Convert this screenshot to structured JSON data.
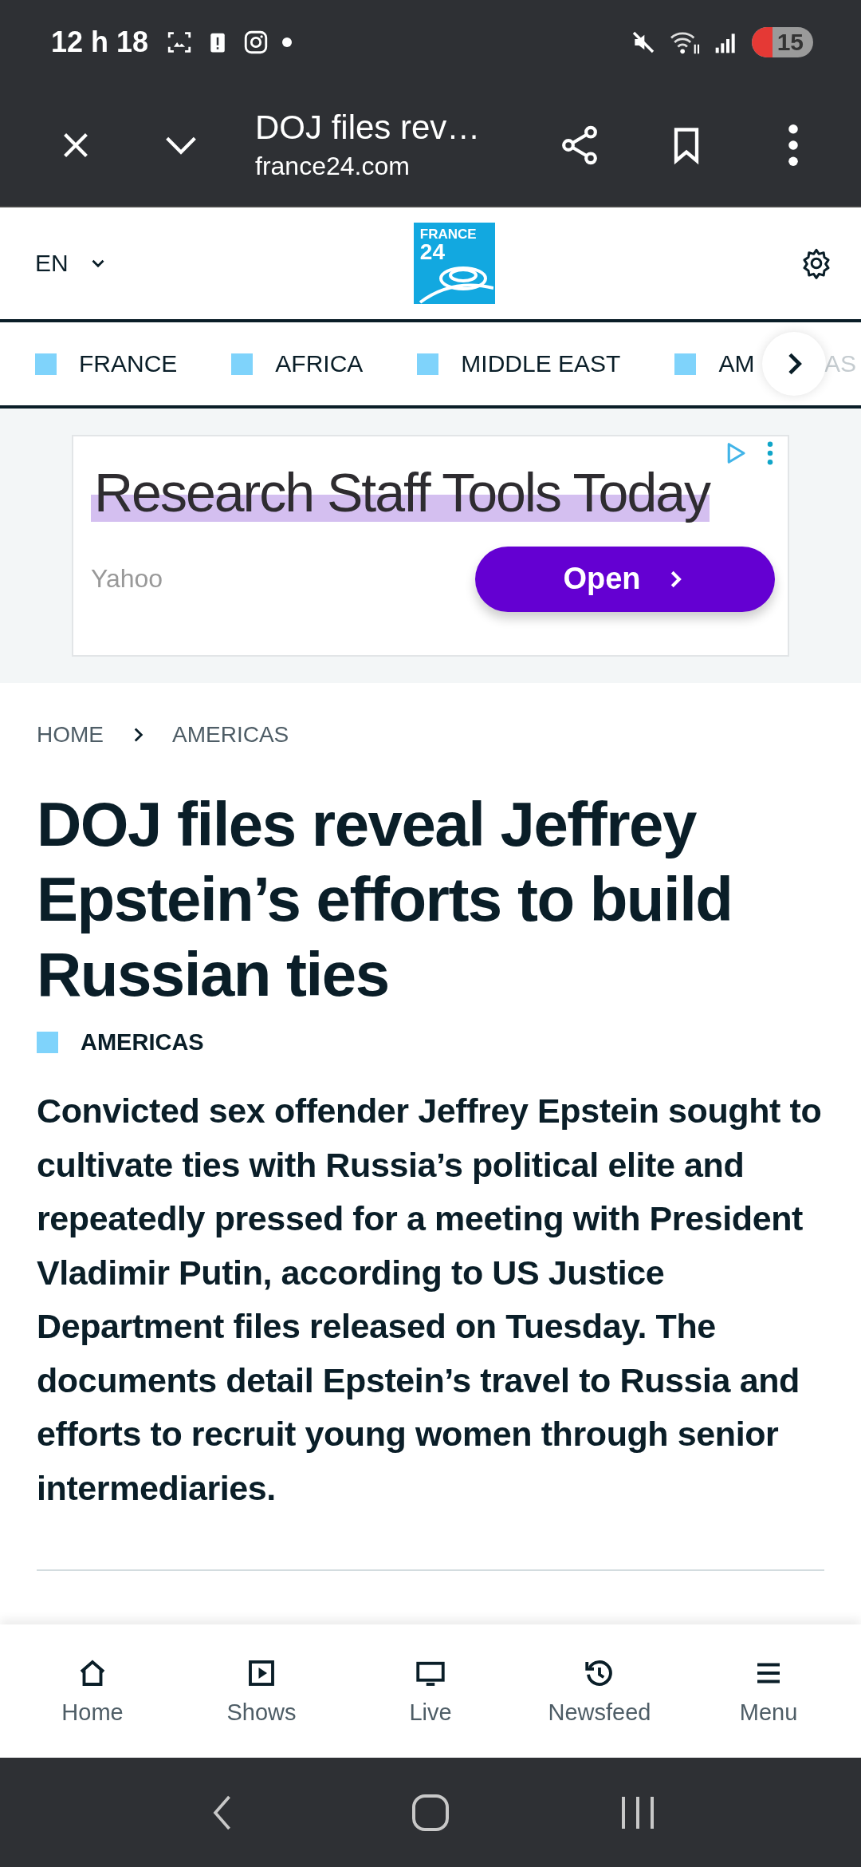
{
  "status_bar": {
    "time": "12 h 18",
    "battery": "15"
  },
  "browser_toolbar": {
    "title": "DOJ files rev…",
    "url": "france24.com"
  },
  "site_header": {
    "language": "EN",
    "logo": [
      "FRANCE",
      "24"
    ]
  },
  "section_nav": [
    {
      "label": "FRANCE",
      "faded": false
    },
    {
      "label": "AFRICA",
      "faded": false
    },
    {
      "label": "MIDDLE EAST",
      "faded": false
    },
    {
      "label": "AM",
      "faded": false
    },
    {
      "label": "AS",
      "faded": true
    }
  ],
  "ad": {
    "title": "Research Staff Tools Today",
    "source": "Yahoo",
    "button": "Open"
  },
  "breadcrumb": [
    "HOME",
    "AMERICAS"
  ],
  "article": {
    "headline": "DOJ files reveal Jeffrey Epstein’s efforts to build Russian ties",
    "category": "AMERICAS",
    "summary": "Convicted sex offender Jeffrey Epstein sought to cultivate ties with Russia’s political elite and repeatedly pressed for a meeting with President Vladimir Putin, according to US Justice Department files released on Tuesday. The documents detail Epstein’s travel to Russia and efforts to recruit young women through senior intermediaries."
  },
  "bottom_nav": [
    {
      "kind": "home",
      "label": "Home"
    },
    {
      "kind": "shows",
      "label": "Shows"
    },
    {
      "kind": "live",
      "label": "Live"
    },
    {
      "kind": "newsfeed",
      "label": "Newsfeed"
    },
    {
      "kind": "menu",
      "label": "Menu"
    }
  ]
}
